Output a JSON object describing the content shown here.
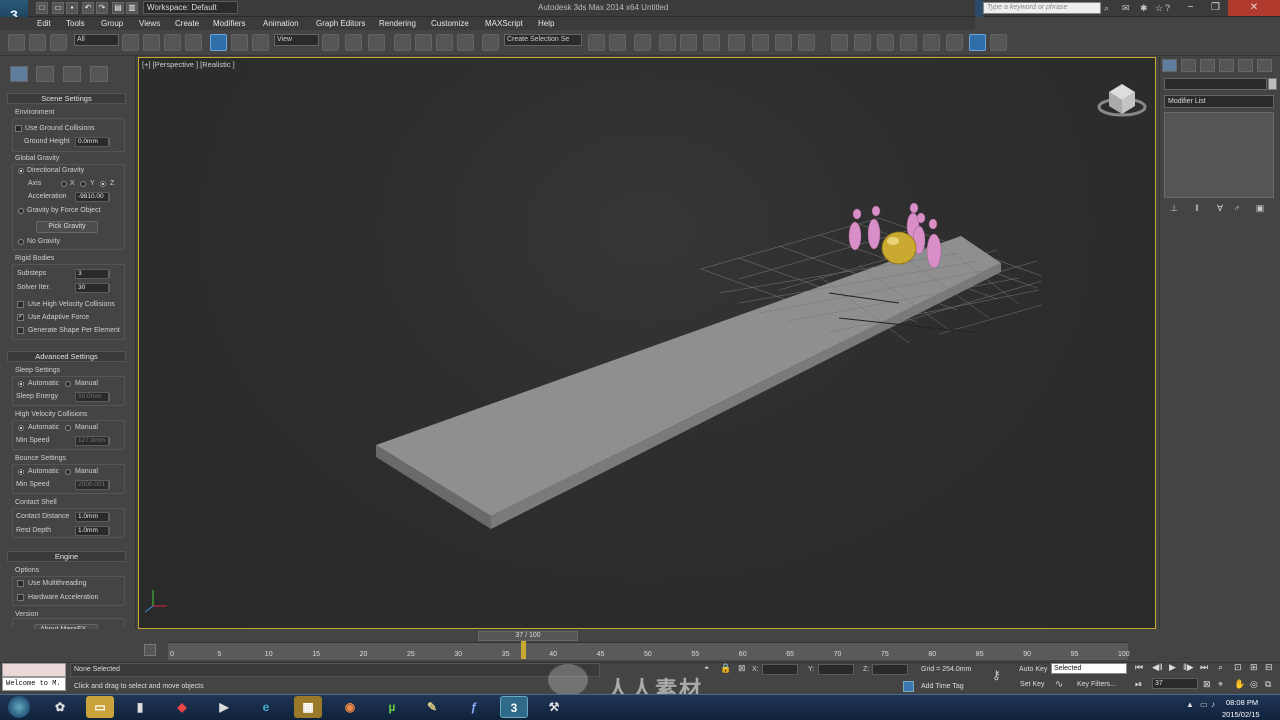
{
  "window": {
    "title": "Autodesk 3ds Max  2014 x64     Untitled",
    "workspace": "Workspace: Default",
    "search_placeholder": "Type a keyword or phrase"
  },
  "menu": [
    "Edit",
    "Tools",
    "Group",
    "Views",
    "Create",
    "Modifiers",
    "Animation",
    "Graph Editors",
    "Rendering",
    "Customize",
    "MAXScript",
    "Help"
  ],
  "toolbar": {
    "selection_filter": "All",
    "reference_coord": "View",
    "named_selection": "Create Selection Se"
  },
  "viewport": {
    "label": "[+] [Perspective ] [Realistic ]"
  },
  "massfx": {
    "scene_settings": {
      "header": "Scene Settings",
      "environment": "Environment",
      "use_ground": "Use Ground Collisions",
      "ground_height_label": "Ground Height",
      "ground_height": "0.0mm",
      "global_gravity": "Global Gravity",
      "directional_gravity": "Directional Gravity",
      "axis_label": "Axis",
      "axis_x": "X",
      "axis_y": "Y",
      "axis_z": "Z",
      "acceleration_label": "Acceleration",
      "acceleration": "-9810.00",
      "gravity_by_force": "Gravity by Force Object",
      "pick_gravity": "Pick Gravity",
      "no_gravity": "No Gravity",
      "rigid_bodies": "Rigid Bodies",
      "substeps_label": "Substeps",
      "substeps": "3",
      "solver_label": "Solver Iter.",
      "solver": "30",
      "high_velocity": "Use High Velocity Collisions",
      "adaptive_force": "Use Adaptive Force",
      "generate_shape": "Generate Shape Per Element"
    },
    "advanced": {
      "header": "Advanced Settings",
      "sleep_settings": "Sleep Settings",
      "automatic": "Automatic",
      "manual": "Manual",
      "sleep_energy_label": "Sleep Energy",
      "sleep_energy": "50.0mm",
      "high_velocity_collisions": "High Velocity Collisions",
      "min_speed_label": "Min Speed",
      "min_speed_hv": "127.0mm",
      "bounce_settings": "Bounce Settings",
      "min_speed_bounce": "2000.001",
      "contact_shell": "Contact Shell",
      "contact_distance_label": "Contact Distance",
      "contact_distance": "1.0mm",
      "rest_depth_label": "Rest Depth",
      "rest_depth": "1.0mm"
    },
    "engine": {
      "header": "Engine",
      "options": "Options",
      "multithreading": "Use Multithreading",
      "hardware_accel": "Hardware Acceleration",
      "version": "Version",
      "about": "About MassFX..."
    }
  },
  "right_panel": {
    "modifier_list": "Modifier List"
  },
  "timeline": {
    "frame_display": "37 / 100",
    "ticks": [
      "0",
      "5",
      "10",
      "15",
      "20",
      "25",
      "30",
      "35",
      "40",
      "45",
      "50",
      "55",
      "60",
      "65",
      "70",
      "75",
      "80",
      "85",
      "90",
      "95",
      "100"
    ],
    "current_frame": 37,
    "total_frames": 100
  },
  "status": {
    "maxscript_input": "Welcome to M.",
    "selection": "None Selected",
    "prompt": "Click and drag to select and move objects",
    "x_label": "X:",
    "y_label": "Y:",
    "z_label": "Z:",
    "grid": "Grid = 254.0mm",
    "add_time_tag": "Add Time Tag",
    "auto_key": "Auto Key",
    "auto_key_mode": "Selected",
    "set_key": "Set Key",
    "key_filters": "Key Filters...",
    "frame_field": "37"
  },
  "watermark": "人人素材",
  "taskbar": {
    "time": "08:08 PM",
    "date": "2015/02/15"
  }
}
